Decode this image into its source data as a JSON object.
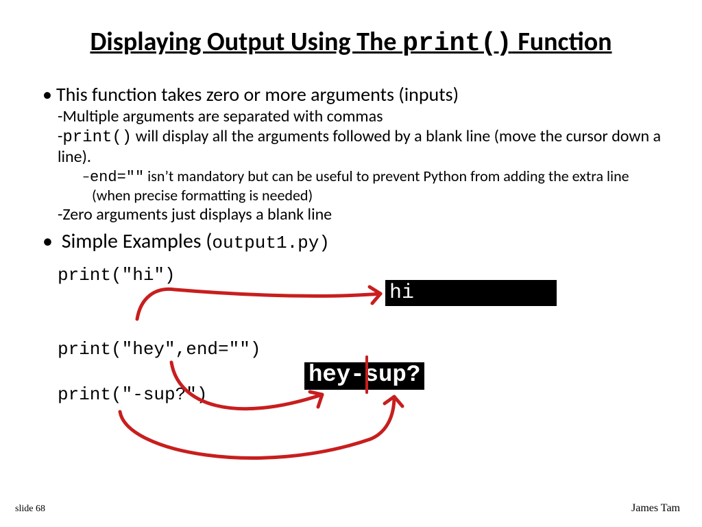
{
  "title_prefix": "Displaying Output Using The ",
  "title_code": "print()",
  "title_suffix": " Function",
  "bullet_a": "This function takes zero or more arguments (inputs)",
  "sub_a1": "-Multiple arguments are separated with commas",
  "sub_a2_dash": "-",
  "sub_a2_code": "print()",
  "sub_a2_rest": "  will display all the arguments followed by a blank line (move the cursor down a line).",
  "subsub_a2a_dash": "–",
  "subsub_a2a_code": "end=\"\"",
  "subsub_a2a_rest": " isn’t mandatory but can be useful to prevent Python from adding  the extra line (when precise formatting is needed)",
  "sub_a3": "-Zero arguments just displays a blank line",
  "bullet_b_pre": "Simple Examples (",
  "bullet_b_code": "output1.py)",
  "code_line1": "print(\"hi\")",
  "code_line2": "print(\"hey\",end=\"\")",
  "code_line3": "print(\"-sup?\")",
  "output1": "hi",
  "output2": "hey-sup?",
  "footer_left": "slide 68",
  "footer_right": "James Tam"
}
